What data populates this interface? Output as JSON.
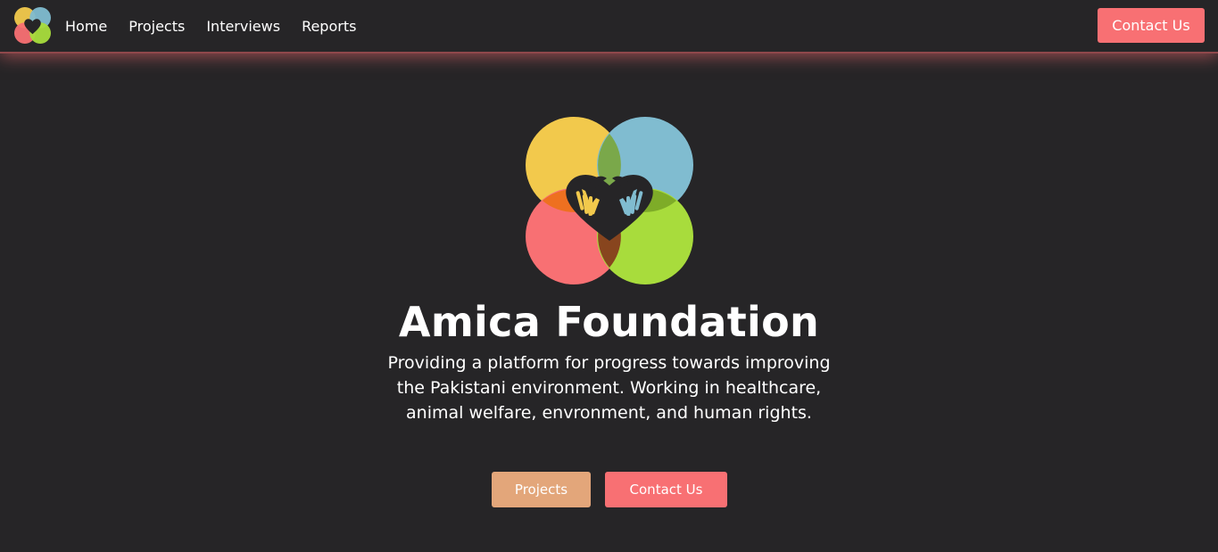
{
  "nav": {
    "links": [
      "Home",
      "Projects",
      "Interviews",
      "Reports"
    ],
    "contact_label": "Contact Us"
  },
  "hero": {
    "title": "Amica Foundation",
    "description": "Providing a platform for progress towards improving the Pakistani environment. Working in healthcare, animal welfare, envronment, and human rights.",
    "buttons": {
      "projects_label": "Projects",
      "contact_label": "Contact Us"
    }
  },
  "icons": {
    "logo": "amica-logo-icon"
  },
  "colors": {
    "background": "#262527",
    "accent": "#f87073",
    "projects_button": "#e3a67a",
    "logo_yellow": "#f2c94c",
    "logo_blue": "#80bcd0",
    "logo_red": "#f87073",
    "logo_green": "#a8dc3c"
  }
}
